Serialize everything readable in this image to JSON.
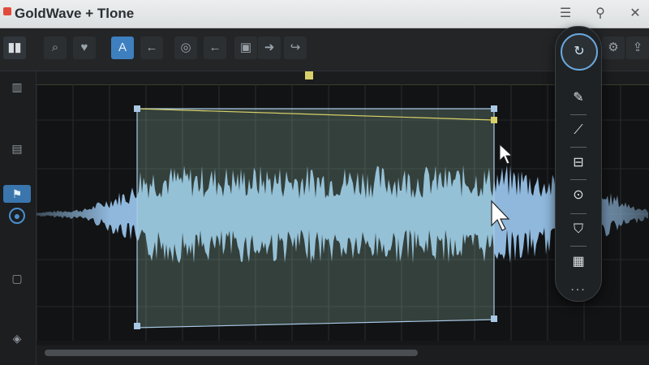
{
  "window": {
    "title": "GoldWave + Tlone"
  },
  "toolbar": {
    "buttons": [
      {
        "name": "logo",
        "glyph": "▮▮"
      },
      {
        "name": "zoom",
        "glyph": "⌕"
      },
      {
        "name": "favorite",
        "glyph": "♥"
      },
      {
        "name": "text-tool",
        "glyph": "A"
      },
      {
        "name": "back",
        "glyph": "←"
      },
      {
        "name": "record",
        "glyph": "◎"
      },
      {
        "name": "left",
        "glyph": "←"
      },
      {
        "name": "file",
        "glyph": "▣"
      },
      {
        "name": "forward",
        "glyph": "➜"
      },
      {
        "name": "curve",
        "glyph": "↪"
      }
    ],
    "right": [
      {
        "name": "user-settings",
        "glyph": "⚙"
      },
      {
        "name": "share",
        "glyph": "⇪"
      }
    ]
  },
  "panel": {
    "tools": [
      {
        "name": "refresh-tool",
        "glyph": "↻"
      },
      {
        "name": "pencil-tool",
        "glyph": "✎"
      },
      {
        "name": "line-tool",
        "glyph": "⟋"
      },
      {
        "name": "clip-tool",
        "glyph": "⊟"
      },
      {
        "name": "download-tool",
        "glyph": "⊙"
      },
      {
        "name": "shield-tool",
        "glyph": "⛉"
      },
      {
        "name": "grid-tool",
        "glyph": "▦"
      }
    ],
    "more": "..."
  },
  "colors": {
    "accent": "#3e7fbf",
    "wave": "#8fb8dc",
    "selection": "#aee4c8",
    "envelope": "#d8d16a"
  }
}
